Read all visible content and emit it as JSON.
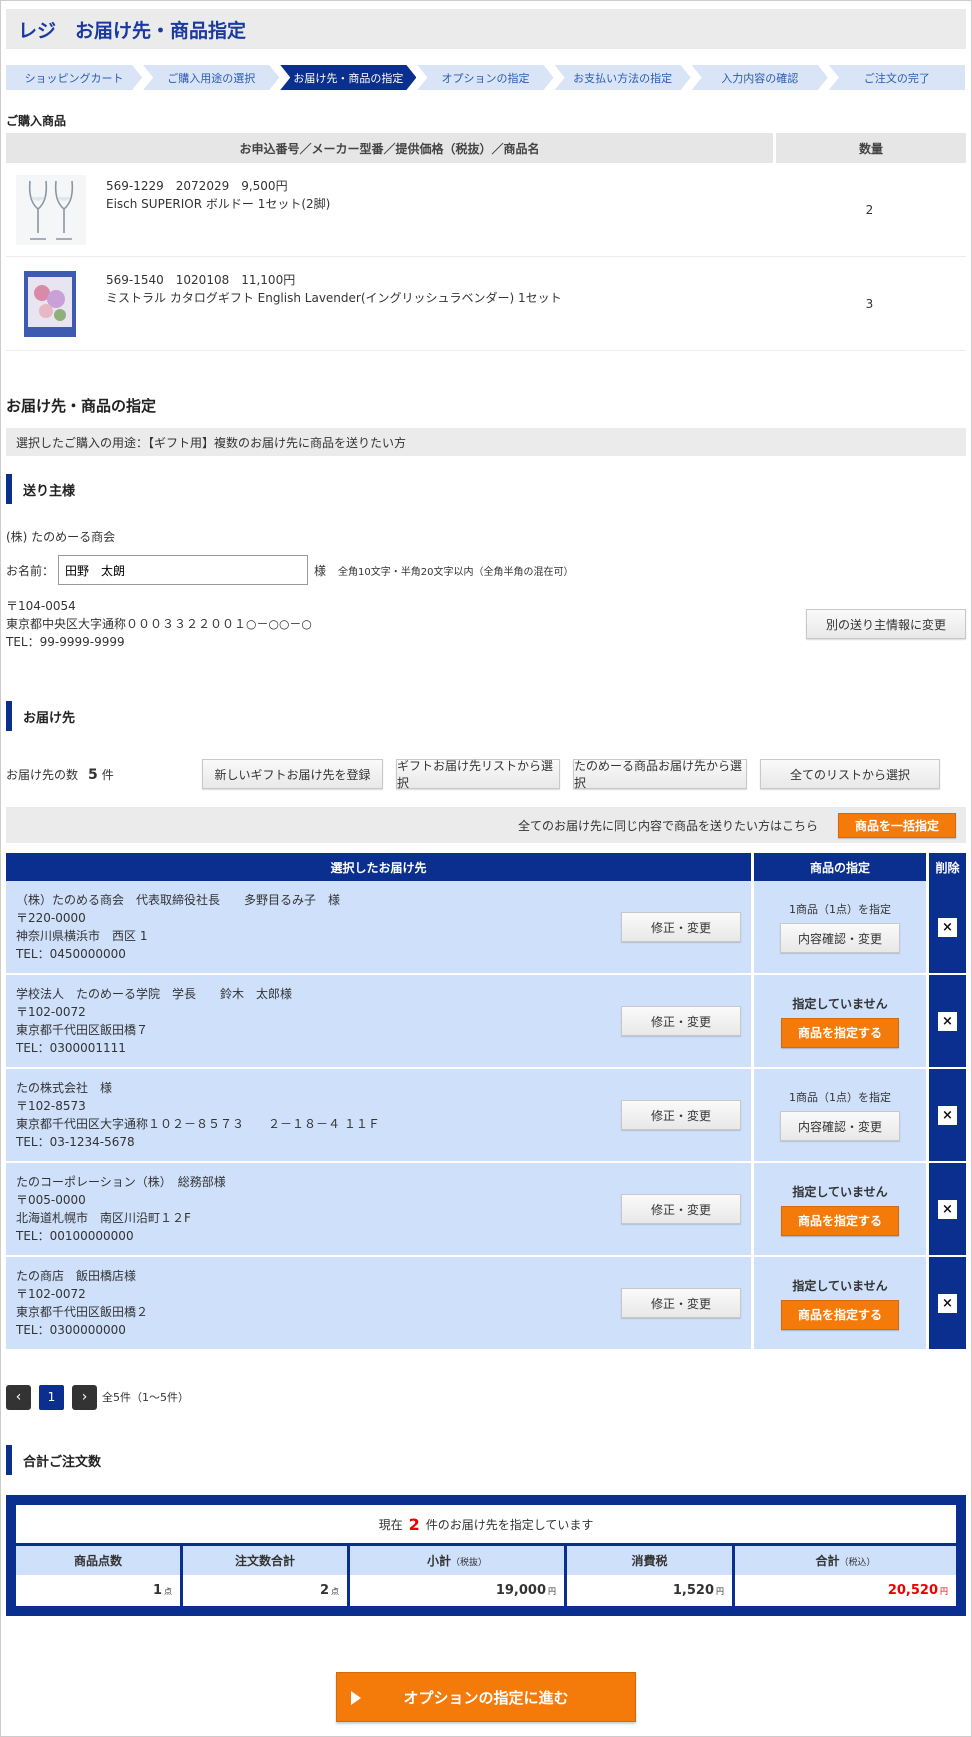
{
  "header": {
    "title": "レジ　お届け先・商品指定"
  },
  "steps": [
    {
      "label": "ショッピングカート"
    },
    {
      "label": "ご購入用途の選択"
    },
    {
      "label": "お届け先・商品の指定"
    },
    {
      "label": "オプションの指定"
    },
    {
      "label": "お支払い方法の指定"
    },
    {
      "label": "入力内容の確認"
    },
    {
      "label": "ご注文の完了"
    }
  ],
  "products": {
    "section_label": "ご購入商品",
    "col_main": "お申込番号／メーカー型番／提供価格（税抜）／商品名",
    "col_qty": "数量",
    "items": [
      {
        "code": "569-1229　2072029　9,500円",
        "name": "Eisch SUPERIOR ボルドー 1セット(2脚)",
        "qty": "2",
        "image_icon": "wine-glasses-image"
      },
      {
        "code": "569-1540　1020108　11,100円",
        "name": "ミストラル カタログギフト English Lavender(イングリッシュラベンダー) 1セット",
        "qty": "3",
        "image_icon": "catalog-gift-image"
      }
    ]
  },
  "delivery": {
    "section_title": "お届け先・商品の指定",
    "use_text": "選択したご購入の用途：【ギフト用】複数のお届け先に商品を送りたい方"
  },
  "sender": {
    "heading": "送り主様",
    "company": "(株) たのめーる商会",
    "name_label": "お名前：",
    "name_value": "田野　太朗",
    "honorific": "様",
    "name_note": "全角10文字・半角20文字以内（全角半角の混在可）",
    "zip": "〒104-0054",
    "address": "東京都中央区大字通称０００３３２２００１○－○○－○",
    "tel": "TEL：99-9999-9999",
    "change_button": "別の送り主情報に変更"
  },
  "recipients": {
    "heading": "お届け先",
    "count_label": "お届け先の数",
    "count": "5",
    "count_unit": "件",
    "buttons": [
      "新しいギフトお届け先を登録",
      "ギフトお届け先リストから選択",
      "たのめーる商品お届け先から選択",
      "全てのリストから選択"
    ],
    "bulk_text": "全てのお届け先に同じ内容で商品を送りたい方はこちら",
    "bulk_button": "商品を一括指定",
    "col_selected": "選択したお届け先",
    "col_spec": "商品の指定",
    "col_delete": "削除",
    "edit_button": "修正・変更",
    "delete_mark": "×",
    "rows": [
      {
        "name": "（株）たのめる商会　代表取締役社長　　多野目るみ子　様",
        "zip": "〒220-0000",
        "addr": "神奈川県横浜市　西区 1",
        "tel": "TEL：0450000000",
        "status": "1商品（1点）を指定",
        "assigned": true,
        "action": "内容確認・変更"
      },
      {
        "name": "学校法人　たのめーる学院　学長　　鈴木　太郎様",
        "zip": "〒102-0072",
        "addr": "東京都千代田区飯田橋７",
        "tel": "TEL：0300001111",
        "status": "指定していません",
        "assigned": false,
        "action": "商品を指定する"
      },
      {
        "name": "たの株式会社　様",
        "zip": "〒102-8573",
        "addr": "東京都千代田区大字通称１０２－８５７３　　２－１８－４ １１Ｆ",
        "tel": "TEL：03-1234-5678",
        "status": "1商品（1点）を指定",
        "assigned": true,
        "action": "内容確認・変更"
      },
      {
        "name": "たのコーポレーション（株）　総務部様",
        "zip": "〒005-0000",
        "addr": "北海道札幌市　南区川沿町１２F",
        "tel": "TEL：00100000000",
        "status": "指定していません",
        "assigned": false,
        "action": "商品を指定する"
      },
      {
        "name": "たの商店　飯田橋店様",
        "zip": "〒102-0072",
        "addr": "東京都千代田区飯田橋２",
        "tel": "TEL：0300000000",
        "status": "指定していません",
        "assigned": false,
        "action": "商品を指定する"
      }
    ]
  },
  "pager": {
    "prev": "‹",
    "current": "1",
    "next": "›",
    "total": "全5件（1〜5件）"
  },
  "summary": {
    "heading": "合計ご注文数",
    "now_prefix": "現在",
    "now_count": "2",
    "now_suffix": "件のお届け先を指定しています",
    "headers": [
      "商品点数",
      "注文数合計",
      "小計",
      "消費税",
      "合計"
    ],
    "header_notes": [
      "",
      "",
      "（税抜）",
      "",
      "（税込）"
    ],
    "values": [
      "1",
      "2",
      "19,000",
      "1,520",
      "20,520"
    ],
    "units": [
      "点",
      "点",
      "円",
      "円",
      "円"
    ]
  },
  "proceed_button": "オプションの指定に進む",
  "colors": {
    "navy": "#0a2f8f",
    "orange": "#f47a0a",
    "light_blue": "#cfe0fb",
    "red": "#e00000"
  }
}
